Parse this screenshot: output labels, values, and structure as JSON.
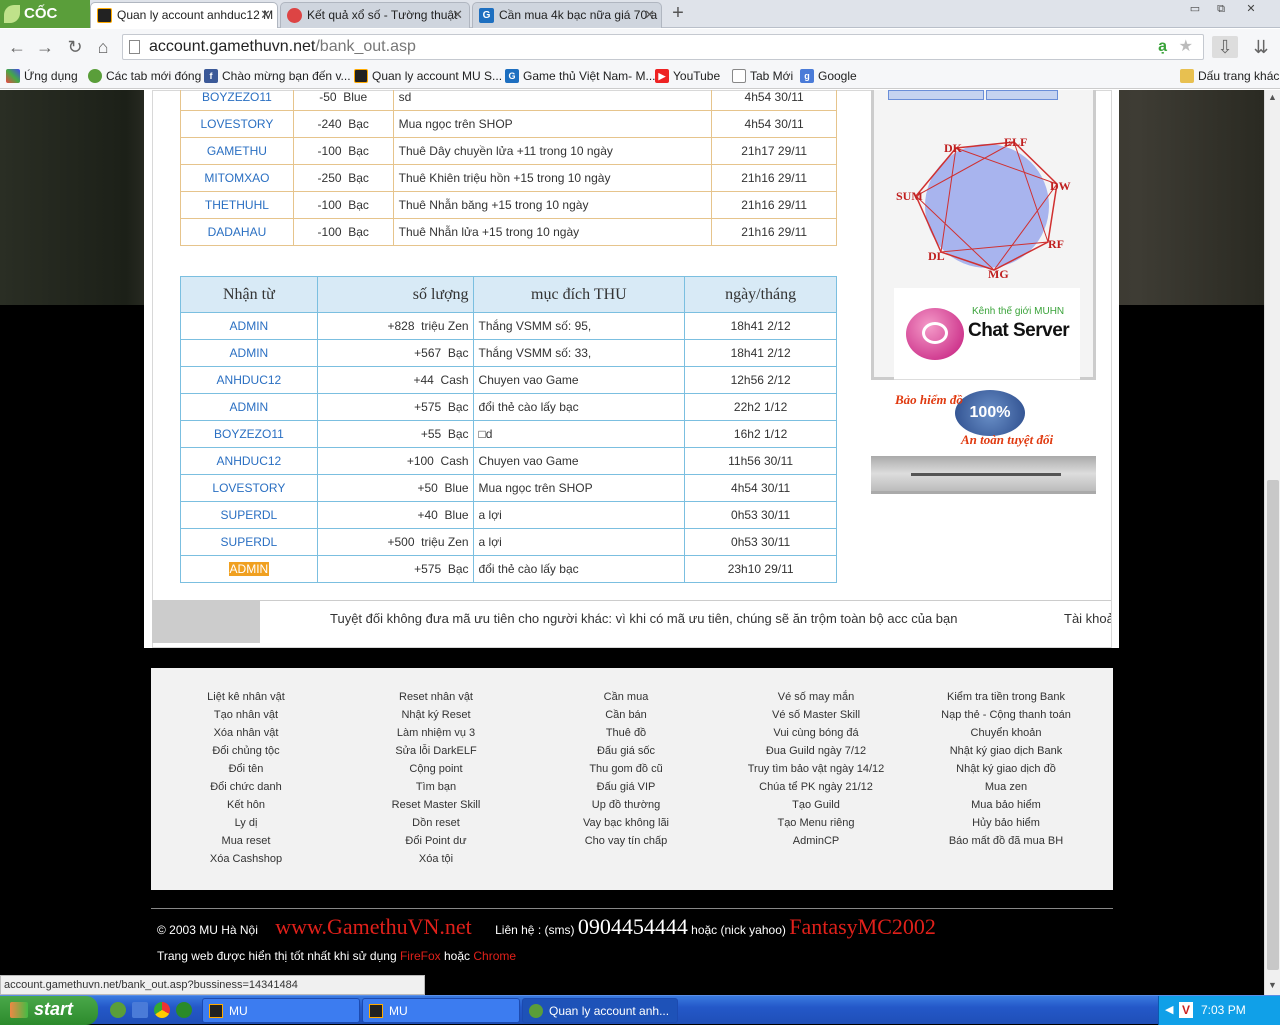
{
  "tabs": [
    {
      "title": "Quan ly account anhduc12 M"
    },
    {
      "title": "Kết quả xổ số - Tường thuật"
    },
    {
      "title": "Cần mua 4k bạc nữa giá 70 a"
    }
  ],
  "browser": {
    "logo": "CỐC CỐC",
    "new_tab": "+",
    "win_min": "▭",
    "win_max": "⧉",
    "win_close": "✕"
  },
  "address": {
    "domain": "account.gamethuvn.net",
    "path": "/bank_out.asp"
  },
  "bookmarks": [
    {
      "label": "Ứng dụng"
    },
    {
      "label": "Các tab mới đóng"
    },
    {
      "label": "Chào mừng bạn đến v..."
    },
    {
      "label": "Quan ly account MU S..."
    },
    {
      "label": "Game thủ Việt Nam- M..."
    },
    {
      "label": "YouTube"
    },
    {
      "label": "Tab Mới"
    },
    {
      "label": "Google"
    },
    {
      "label": "Dấu trang khác"
    }
  ],
  "table_out": {
    "rows": [
      {
        "name": "BOYZEZO11",
        "qty": "-50  Blue",
        "purpose": "sd",
        "date": "4h54 30/11"
      },
      {
        "name": "LOVESTORY",
        "qty": "-240  Bạc",
        "purpose": "Mua ngọc trên SHOP",
        "date": "4h54 30/11"
      },
      {
        "name": "GAMETHU",
        "qty": "-100  Bạc",
        "purpose": "Thuê Dây chuyền lửa +11 trong 10 ngày",
        "date": "21h17 29/11"
      },
      {
        "name": "MITOMXAO",
        "qty": "-250  Bạc",
        "purpose": "Thuê Khiên triệu hồn +15 trong 10 ngày",
        "date": "21h16 29/11"
      },
      {
        "name": "THETHUHL",
        "qty": "-100  Bạc",
        "purpose": "Thuê Nhẫn băng +15 trong 10 ngày",
        "date": "21h16 29/11"
      },
      {
        "name": "DADAHAU",
        "qty": "-100  Bạc",
        "purpose": "Thuê Nhẫn lửa +15 trong 10 ngày",
        "date": "21h16 29/11"
      }
    ]
  },
  "table_in": {
    "headers": {
      "from": "Nhận từ",
      "qty": "số lượng",
      "purpose": "mục đích THU",
      "date": "ngày/tháng"
    },
    "rows": [
      {
        "name": "ADMIN",
        "qty": "+828  triệu Zen",
        "purpose": "Thắng VSMM số: 95,",
        "date": "18h41 2/12"
      },
      {
        "name": "ADMIN",
        "qty": "+567  Bạc",
        "purpose": "Thắng VSMM số: 33,",
        "date": "18h41 2/12"
      },
      {
        "name": "ANHDUC12",
        "qty": "+44  Cash",
        "purpose": "Chuyen vao Game",
        "date": "12h56 2/12"
      },
      {
        "name": "ADMIN",
        "qty": "+575  Bạc",
        "purpose": "đổi thẻ cào lấy bạc",
        "date": "22h2 1/12"
      },
      {
        "name": "BOYZEZO11",
        "qty": "+55  Bạc",
        "purpose": "□d",
        "date": "16h2 1/12"
      },
      {
        "name": "ANHDUC12",
        "qty": "+100  Cash",
        "purpose": "Chuyen vao Game",
        "date": "11h56 30/11"
      },
      {
        "name": "LOVESTORY",
        "qty": "+50  Blue",
        "purpose": "Mua ngọc trên SHOP",
        "date": "4h54 30/11"
      },
      {
        "name": "SUPERDL",
        "qty": "+40  Blue",
        "purpose": "a lợi",
        "date": "0h53 30/11"
      },
      {
        "name": "SUPERDL",
        "qty": "+500  triệu Zen",
        "purpose": "a lợi",
        "date": "0h53 30/11"
      },
      {
        "name": "ADMIN",
        "qty": "+575  Bạc",
        "purpose": "đổi thẻ cào lấy bạc",
        "date": "23h10 29/11"
      }
    ]
  },
  "marquee": {
    "text": "Tuyệt đối không đưa mã ưu tiên cho người khác: vì khi có mã ưu tiên, chúng sẽ ăn trộm toàn bộ acc của bạn",
    "tail": "Tài khoả"
  },
  "sidebar": {
    "classes": [
      "DK",
      "ELF",
      "DW",
      "RF",
      "MG",
      "DL",
      "SUM"
    ],
    "chat_small": "Kênh thế giới MUHN",
    "chat_big": "Chat Server",
    "ins_top": "Bảo hiểm đồ",
    "ins_seal": "100%",
    "ins_bottom": "An toàn tuyệt đối"
  },
  "footer": {
    "columns": [
      [
        "Liệt kê nhân vật",
        "Tạo nhân vật",
        "Xóa nhân vật",
        "Đổi chủng tộc",
        "Đổi tên",
        "Đổi chức danh",
        "Kết hôn",
        "Ly dị",
        "Mua reset",
        "Xóa Cashshop"
      ],
      [
        "Reset nhân vật",
        "Nhật ký Reset",
        "Làm nhiệm vụ 3",
        "Sửa lỗi DarkELF",
        "Cộng point",
        "Tìm bạn",
        "Reset Master Skill",
        "Dồn reset",
        "Đổi Point dư",
        "Xóa tội"
      ],
      [
        "Cần mua",
        "Cần bán",
        "Thuê đồ",
        "Đấu giá sốc",
        "Thu gom đồ cũ",
        "Đấu giá VIP",
        "Up đồ thường",
        "Vay bạc không lãi",
        "Cho vay tín chấp"
      ],
      [
        "Vé số may mắn",
        "Vé số Master Skill",
        "Vui cùng bóng đá",
        "Đua Guild ngày 7/12",
        "Truy tìm bảo vật ngày 14/12",
        "Chúa tể PK ngày 21/12",
        "Tạo Guild",
        "Tạo Menu riêng",
        "AdminCP"
      ],
      [
        "Kiểm tra tiền trong Bank",
        "Nạp thẻ - Cộng thanh toán",
        "Chuyển khoản",
        "Nhật ký giao dịch Bank",
        "Nhật ký giao dịch đồ",
        "Mua zen",
        "Mua bảo hiểm",
        "Hủy bảo hiểm",
        "Báo mất đồ đã mua BH"
      ]
    ]
  },
  "credits": {
    "copyright": "© 2003 MU Hà Nội",
    "site": "www.GamethuVN.net",
    "contact_label": "Liên hệ : (sms)",
    "phone": "0904454444",
    "or_yahoo": "hoặc (nick yahoo)",
    "yahoo": "FantasyMC2002",
    "best_view": "Trang web được hiển thị tốt nhất khi sử dụng",
    "firefox": "FireFox",
    "or": "hoặc",
    "chrome": "Chrome"
  },
  "status_url": "account.gamethuvn.net/bank_out.asp?bussiness=14341484",
  "taskbar": {
    "start": "start",
    "tasks": [
      {
        "label": "MU"
      },
      {
        "label": "MU"
      },
      {
        "label": "Quan ly account anh..."
      }
    ],
    "clock": "7:03 PM"
  },
  "colors": {
    "link": "#2a6fc2",
    "accent_red": "#e0201a",
    "table_out_border": "#e6c48c",
    "table_in_border": "#7bbfe0"
  }
}
